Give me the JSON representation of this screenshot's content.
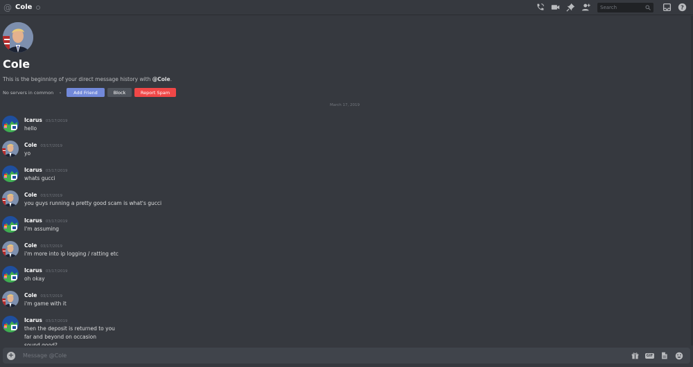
{
  "header": {
    "channel_name": "Cole",
    "search_placeholder": "Search",
    "icons": [
      "call-icon",
      "video-icon",
      "pin-icon",
      "add-member-icon",
      "inbox-icon",
      "help-icon"
    ]
  },
  "intro": {
    "name": "Cole",
    "desc_prefix": "This is the beginning of your direct message history with ",
    "desc_mention": "@Cole",
    "desc_suffix": ".",
    "no_servers": "No servers in common",
    "add_friend_label": "Add Friend",
    "block_label": "Block",
    "report_label": "Report Spam"
  },
  "date_divider": "March 17, 2019",
  "messages": [
    {
      "author": "Icarus",
      "time": "03/17/2019",
      "lines": [
        "hello"
      ]
    },
    {
      "author": "Cole",
      "time": "03/17/2019",
      "lines": [
        "yo"
      ]
    },
    {
      "author": "Icarus",
      "time": "03/17/2019",
      "lines": [
        "whats gucci"
      ]
    },
    {
      "author": "Cole",
      "time": "03/17/2019",
      "lines": [
        "you guys running a pretty good scam is what's gucci"
      ]
    },
    {
      "author": "Icarus",
      "time": "03/17/2019",
      "lines": [
        "I'm assuming"
      ]
    },
    {
      "author": "Cole",
      "time": "03/17/2019",
      "lines": [
        "i'm more into ip logging / ratting etc"
      ]
    },
    {
      "author": "Icarus",
      "time": "03/17/2019",
      "lines": [
        "oh okay"
      ]
    },
    {
      "author": "Cole",
      "time": "03/17/2019",
      "lines": [
        "i'm game with it"
      ]
    },
    {
      "author": "Icarus",
      "time": "03/17/2019",
      "lines": [
        "then the deposit is returned to you",
        "far and beyond on occasion",
        "sound good?"
      ]
    }
  ],
  "composer": {
    "placeholder": "Message @Cole",
    "icons": [
      "gift-icon",
      "gif-icon",
      "file-icon",
      "emoji-icon"
    ],
    "gif_label": "GIF"
  },
  "colors": {
    "background": "#36393f",
    "accent_blurple": "#7289da",
    "danger_red": "#f04747",
    "block_grey": "#4f545c"
  }
}
